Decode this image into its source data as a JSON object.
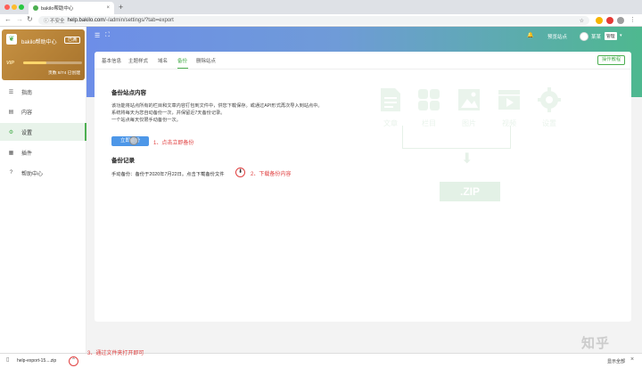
{
  "browser": {
    "tab_title": "bakilo帮助中心",
    "tab_close": "×",
    "new_tab": "+",
    "security": "ⓘ 不安全",
    "url_host": "help.bakilo.com",
    "url_path": "/-/admin/settings/?tab=export",
    "nav_back": "←",
    "nav_forward": "→",
    "nav_reload": "↻"
  },
  "sidebar": {
    "brand_name": "bakilo帮助中心",
    "brand_badge": "已满",
    "vip_label": "VIP",
    "usage_fraction": 0.4,
    "usage_text": "页数 8/74 已创建",
    "items": [
      {
        "label": "指南",
        "icon": "☰"
      },
      {
        "label": "内容",
        "icon": "▤"
      },
      {
        "label": "设置",
        "icon": "⚙"
      },
      {
        "label": "插件",
        "icon": "▦"
      },
      {
        "label": "帮助中心",
        "icon": "?"
      }
    ]
  },
  "header": {
    "menu_icon": "☰",
    "fullscreen_icon": "⛶",
    "bell_icon": "🔔",
    "visit_site": "预览站点",
    "user_name": "某某",
    "user_badge": "管理"
  },
  "tabs": {
    "items": [
      "基本信息",
      "主题样式",
      "域名",
      "备份",
      "删除站点"
    ],
    "active_index": 3,
    "guide_button": "操作教程"
  },
  "backup": {
    "title": "备份站点内容",
    "desc_lines": [
      "该功能将站点所有的栏目和文章内容打包到文件中，供您下载保存。或通过API形式再次导入到站点中。",
      "系统将每天为您自动备份一次，并保留近7天备份记录。",
      "一个站点每天仅限手动备份一次。"
    ],
    "button_label": "立即备份",
    "annotation_1": "1、点击立即备份",
    "record_title": "备份记录",
    "record_text": "手动备份：备份于2020年7月22日。点击下载备份文件",
    "download_icon": "⬇",
    "annotation_2": "2、下载备份内容"
  },
  "illustration": {
    "labels": [
      "文章",
      "栏目",
      "图片",
      "视频",
      "设置"
    ],
    "zip_label": ".ZIP"
  },
  "download_bar": {
    "file_name": "help-export-15....zip",
    "more_icon": "⌃",
    "annotation_3": "3、通过文件夹打开即可",
    "show_all": "显示全部",
    "close": "×"
  },
  "watermark": "知乎",
  "colors": {
    "accent_green": "#4caf50",
    "button_blue": "#4d97e8",
    "annotation_red": "#e04040"
  }
}
